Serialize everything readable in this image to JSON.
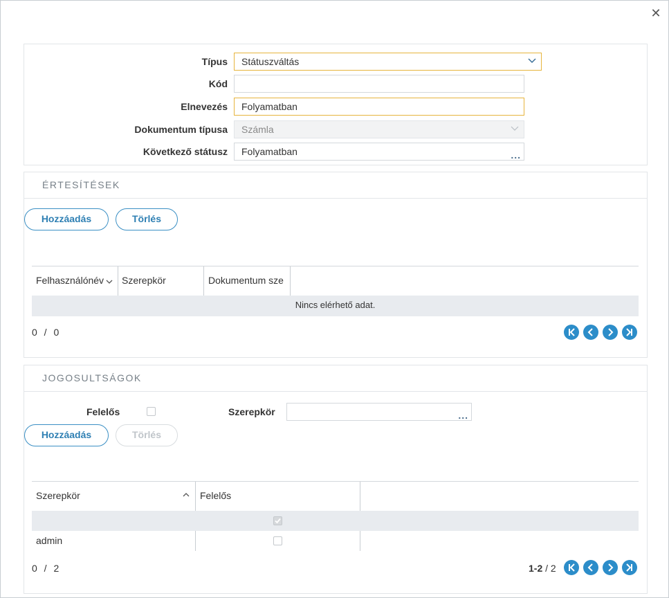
{
  "form": {
    "type_label": "Típus",
    "type_value": "Státuszváltás",
    "code_label": "Kód",
    "code_value": "",
    "name_label": "Elnevezés",
    "name_value": "Folyamatban",
    "doctype_label": "Dokumentum típusa",
    "doctype_value": "Számla",
    "next_status_label": "Következő státusz",
    "next_status_value": "Folyamatban"
  },
  "notifications": {
    "header": "ÉRTESÍTÉSEK",
    "add_label": "Hozzáadás",
    "delete_label": "Törlés",
    "columns": [
      "Felhasználónév",
      "Szerepkör",
      "Dokumentum sze"
    ],
    "empty_text": "Nincs elérhető adat.",
    "pager_count": "0 / 0"
  },
  "permissions": {
    "header": "JOGOSULTSÁGOK",
    "responsible_label": "Felelős",
    "role_label": "Szerepkör",
    "role_value": "",
    "add_label": "Hozzáadás",
    "delete_label": "Törlés",
    "columns": [
      "Szerepkör",
      "Felelős"
    ],
    "rows": [
      {
        "role": "",
        "responsible": true
      },
      {
        "role": "admin",
        "responsible": false
      }
    ],
    "pager_count": "0 / 2",
    "pager_range": "1-2",
    "pager_total": " / 2"
  },
  "icons": {
    "close": "close-icon",
    "dropdown": "chevron-down-icon",
    "more": "ellipsis-icon",
    "first": "first-page-icon",
    "prev": "prev-page-icon",
    "next": "next-page-icon",
    "last": "last-page-icon"
  },
  "colors": {
    "accent": "#2c8dc9",
    "highlight_border": "#e6b43c",
    "row_alt": "#e8ebef"
  }
}
